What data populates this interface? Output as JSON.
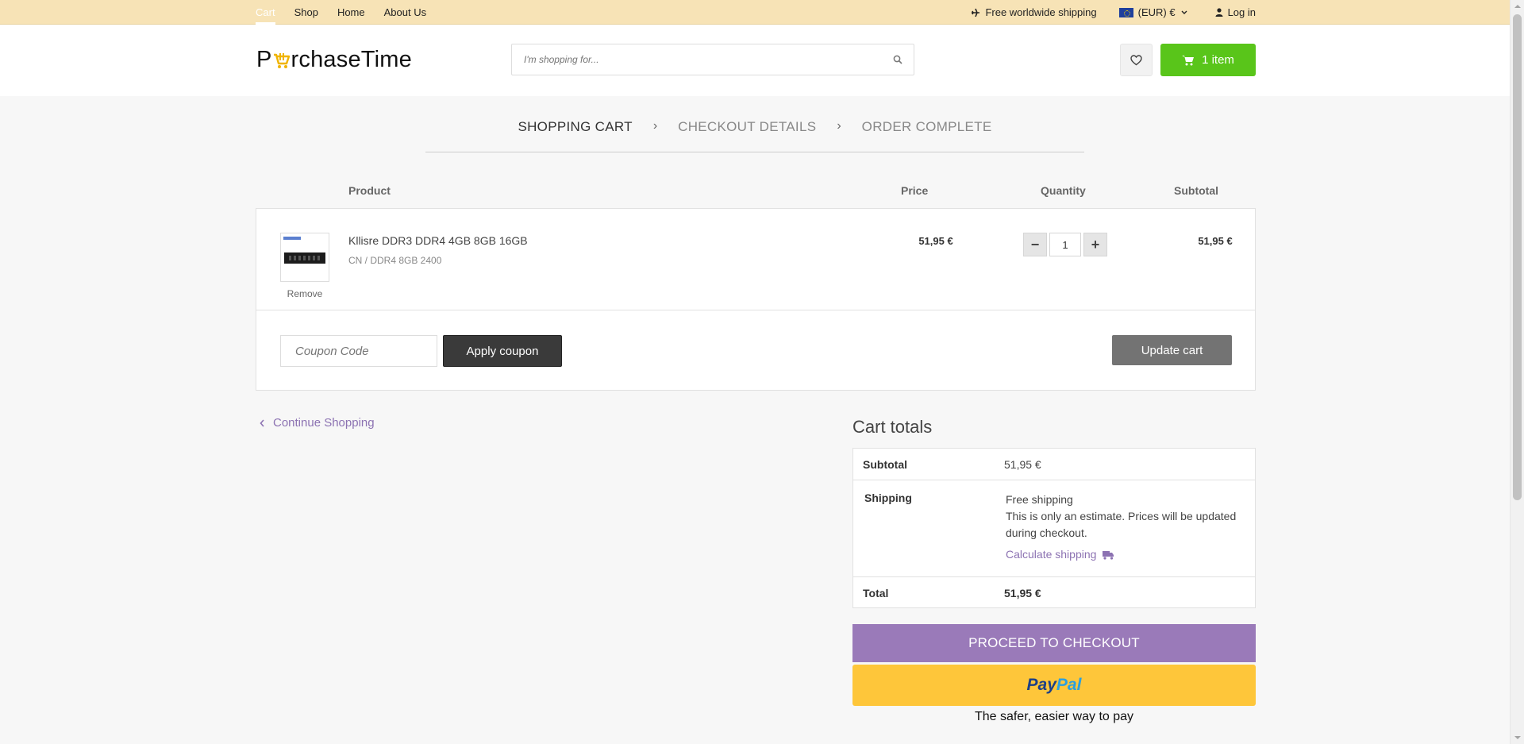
{
  "topbar": {
    "nav": [
      "Cart",
      "Shop",
      "Home",
      "About Us"
    ],
    "shipping": "Free worldwide shipping",
    "currency": "(EUR) €",
    "login": "Log in"
  },
  "header": {
    "logo_p": "P",
    "logo_rest": "rchaseTime",
    "search_placeholder": "I'm shopping for...",
    "cart_label": "1 item"
  },
  "steps": [
    "SHOPPING CART",
    "CHECKOUT DETAILS",
    "ORDER COMPLETE"
  ],
  "table": {
    "headers": {
      "product": "Product",
      "price": "Price",
      "quantity": "Quantity",
      "subtotal": "Subtotal"
    },
    "item": {
      "name": "Kllisre DDR3 DDR4 4GB 8GB 16GB",
      "variant": "CN / DDR4 8GB 2400",
      "remove": "Remove",
      "price": "51,95 €",
      "quantity": "1",
      "subtotal": "51,95 €"
    },
    "coupon_placeholder": "Coupon Code",
    "apply_label": "Apply coupon",
    "update_label": "Update cart"
  },
  "continue_label": "Continue Shopping",
  "totals": {
    "title": "Cart totals",
    "subtotal_label": "Subtotal",
    "subtotal_value": "51,95 €",
    "shipping_label": "Shipping",
    "shipping_value": "Free shipping",
    "shipping_note": "This is only an estimate. Prices will be updated during checkout.",
    "calc_label": "Calculate shipping",
    "total_label": "Total",
    "total_value": "51,95 €"
  },
  "checkout_label": "PROCEED TO CHECKOUT",
  "paypal": {
    "part1": "Pay",
    "part2": "Pal",
    "tagline": "The safer, easier way to pay"
  },
  "colors": {
    "topbar": "#f7e3b6",
    "cart_button": "#59c51a",
    "checkout": "#9a7ab9",
    "paypal": "#fec63a",
    "link": "#8c72b2"
  }
}
